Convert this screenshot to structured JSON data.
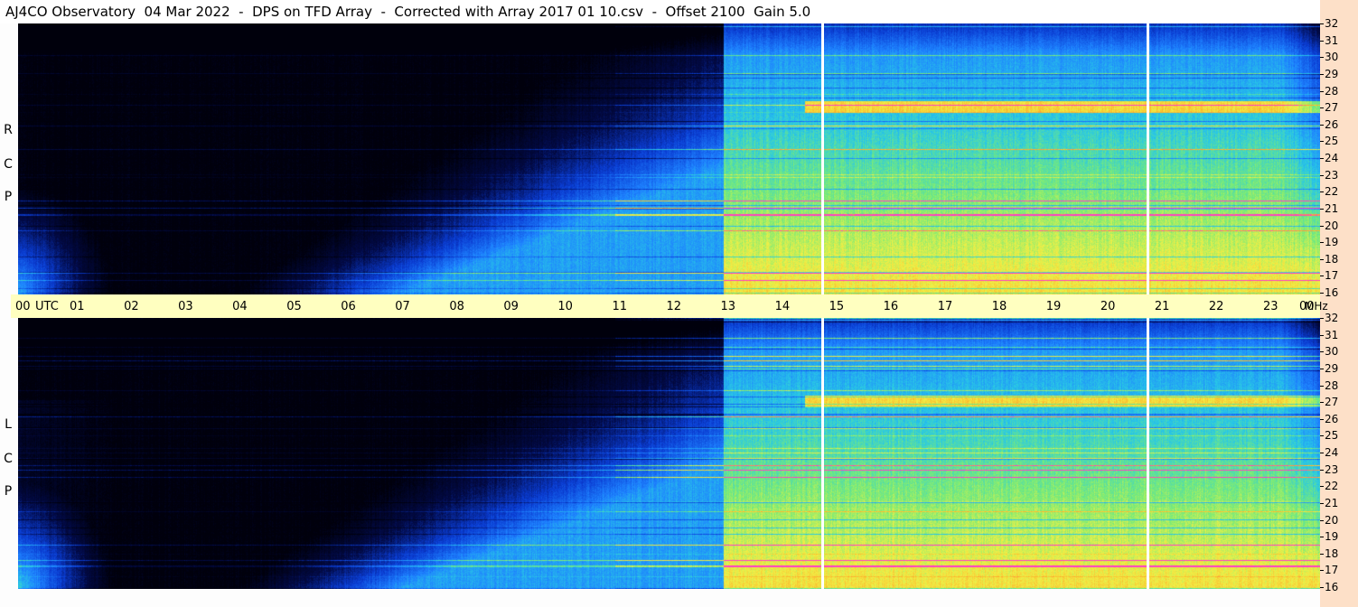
{
  "title": "AJ4CO Observatory  04 Mar 2022  -  DPS on TFD Array  -  Corrected with Array 2017 01 10.csv  -  Offset 2100  Gain 5.0",
  "chart_data": {
    "type": "heatmap",
    "title": "AJ4CO Observatory  04 Mar 2022  -  DPS on TFD Array  -  Corrected with Array 2017 01 10.csv  -  Offset 2100  Gain 5.0",
    "x_ticks": [
      "00",
      "01",
      "02",
      "03",
      "04",
      "05",
      "06",
      "07",
      "08",
      "09",
      "10",
      "11",
      "12",
      "13",
      "14",
      "15",
      "16",
      "17",
      "18",
      "19",
      "20",
      "21",
      "22",
      "23",
      "00"
    ],
    "x_unit_label": "UTC",
    "xlim": [
      0,
      24
    ],
    "y_ticks": [
      "16",
      "17",
      "18",
      "19",
      "20",
      "21",
      "22",
      "23",
      "24",
      "25",
      "26",
      "27",
      "28",
      "29",
      "30",
      "31",
      "32"
    ],
    "y_unit_label": "MHz",
    "ylim": [
      16,
      32
    ],
    "panels": [
      {
        "name": "RCP",
        "label": [
          "R",
          "C",
          "P"
        ]
      },
      {
        "name": "LCP",
        "label": [
          "L",
          "C",
          "P"
        ]
      }
    ],
    "vertical_markers_utc": [
      14.8,
      20.8
    ],
    "colors": {
      "low": "#000010",
      "mid": "#1e78ff",
      "high": "#ffd040",
      "peak": "#ff40c0",
      "axis_bar": "#ffffc0",
      "side_strip": "#fde0c8"
    }
  }
}
